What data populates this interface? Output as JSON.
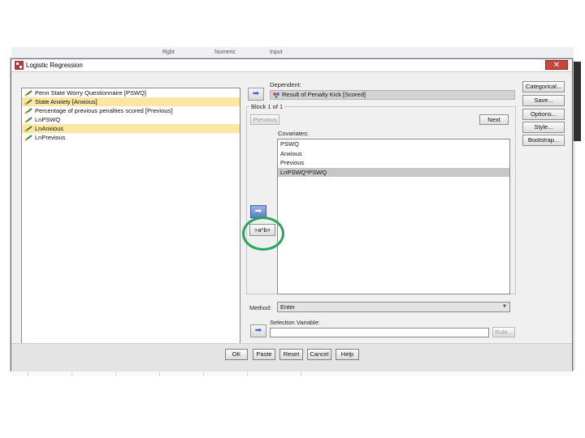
{
  "background_app": {
    "toolbar_labels": [
      "Rgbt",
      "Numeric",
      "Input"
    ]
  },
  "dialog": {
    "title": "Logistic Regression",
    "close_glyph": "✕",
    "source_variables": [
      {
        "label": "Penn State Worry Questionnaire [PSWQ]",
        "selected": false,
        "icon": "scale-variable-icon"
      },
      {
        "label": "State Anxiety [Anxious]",
        "selected": true,
        "icon": "scale-variable-icon"
      },
      {
        "label": "Percentage of previous penalties scored [Previous]",
        "selected": false,
        "icon": "scale-variable-icon"
      },
      {
        "label": "LnPSWQ",
        "selected": false,
        "icon": "scale-variable-icon"
      },
      {
        "label": "LnAnxious",
        "selected": true,
        "icon": "scale-variable-icon"
      },
      {
        "label": "LnPrevious",
        "selected": false,
        "icon": "scale-variable-icon"
      }
    ],
    "dependent": {
      "label": "Dependent:",
      "value": "Result of Penalty Kick [Scored]",
      "icon": "nominal-variable-icon"
    },
    "block": {
      "label": "Block 1 of 1",
      "previous_label": "Previous",
      "next_label": "Next"
    },
    "covariates": {
      "label": "Covariates:",
      "items": [
        {
          "label": "PSWQ",
          "selected": false
        },
        {
          "label": "Anxious",
          "selected": false
        },
        {
          "label": "Previous",
          "selected": false
        },
        {
          "label": "LnPSWQ*PSWQ",
          "selected": true
        }
      ]
    },
    "interaction_button_label": ">a*b>",
    "method": {
      "label": "Method:",
      "value": "Enter"
    },
    "selection_variable": {
      "label": "Selection Variable:",
      "rule_label": "Rule..."
    },
    "side_buttons": [
      "Categorical...",
      "Save...",
      "Options...",
      "Style...",
      "Bootstrap..."
    ],
    "bottom_buttons": [
      "OK",
      "Paste",
      "Reset",
      "Cancel",
      "Help"
    ],
    "colors": {
      "selected_row": "#fbe7a3",
      "highlight_circle": "#27a55a",
      "close_button": "#c9463d"
    }
  }
}
